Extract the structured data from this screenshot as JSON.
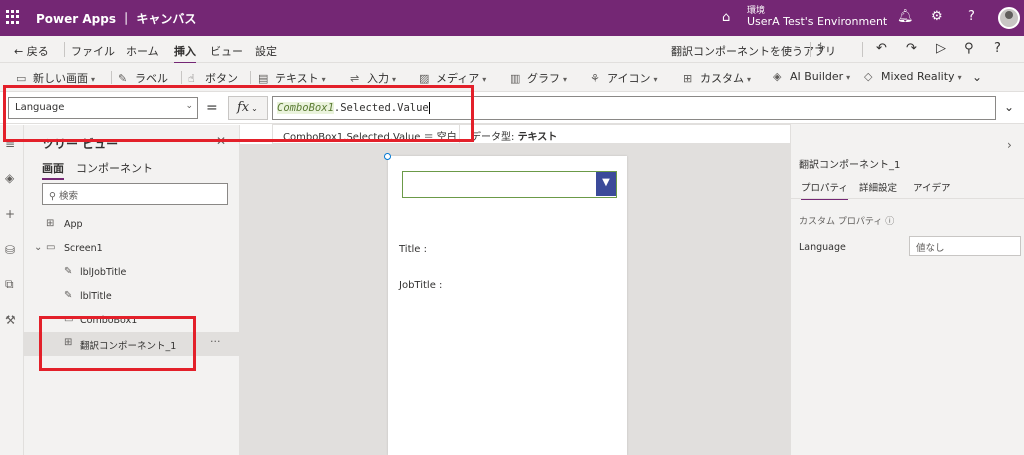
{
  "titlebar": {
    "app": "Power Apps ｜ キャンバス",
    "env_label": "環境",
    "env_name": "UserA Test's Environment",
    "bg_color": "#742774"
  },
  "menubar": {
    "back": "戻る",
    "items": [
      "ファイル",
      "ホーム",
      "挿入",
      "ビュー",
      "設定"
    ],
    "active": "挿入",
    "app_name": "翻訳コンポーネントを使うアプリ"
  },
  "ribbon": {
    "new_screen": "新しい画面",
    "label": "ラベル",
    "button": "ボタン",
    "text": "テキスト",
    "input": "入力",
    "media": "メディア",
    "chart": "グラフ",
    "icon": "アイコン",
    "custom": "カスタム",
    "ai_builder": "AI Builder",
    "mixed_reality": "Mixed Reality"
  },
  "formula": {
    "property": "Language",
    "fx": "fx",
    "token": "ComboBox1",
    "rest": ".Selected.Value",
    "hint_expr": "ComboBox1.Selected.Value ＝ 空白",
    "hint_type_label": "データ型:",
    "hint_type_value": "テキスト"
  },
  "tree": {
    "title": "ツリー ビュー",
    "tab_screens": "画面",
    "tab_components": "コンポーネント",
    "search_placeholder": "検索",
    "items": {
      "app": "App",
      "screen1": "Screen1",
      "lbl_job_title": "lblJobTitle",
      "lbl_title": "lblTitle",
      "combobox1": "ComboBox1",
      "component": "翻訳コンポーネント_1"
    }
  },
  "canvas": {
    "title_label": "Title :",
    "job_title_label": "JobTitle :"
  },
  "properties": {
    "selected_name": "翻訳コンポーネント_1",
    "tabs": [
      "プロパティ",
      "詳細設定",
      "アイデア"
    ],
    "active_tab": "プロパティ",
    "section": "カスタム プロパティ",
    "prop_label": "Language",
    "prop_value": "値なし"
  },
  "annotation_color": "#e3202a"
}
